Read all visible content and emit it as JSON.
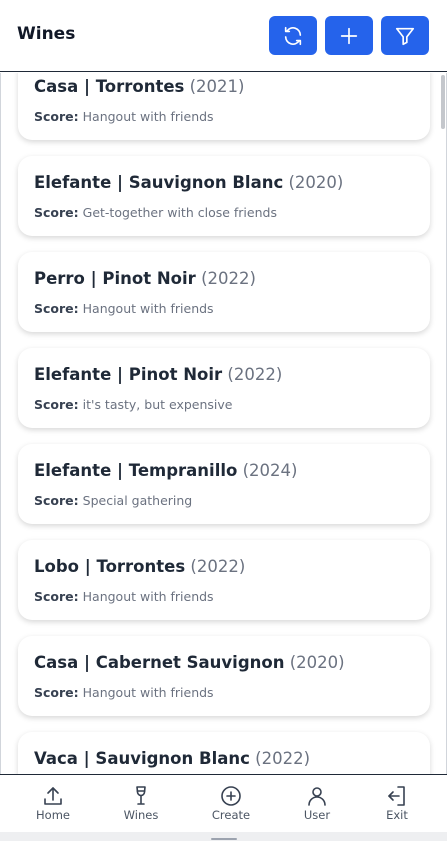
{
  "header": {
    "title": "Wines",
    "buttons": [
      {
        "name": "refresh",
        "icon": "refresh-icon"
      },
      {
        "name": "add",
        "icon": "plus-icon"
      },
      {
        "name": "filter",
        "icon": "filter-icon"
      }
    ],
    "accent": "#2563eb"
  },
  "score_label": "Score:",
  "wines": [
    {
      "name": "Casa | Torrontes",
      "year": "(2021)",
      "score": "Hangout with friends"
    },
    {
      "name": "Elefante | Sauvignon Blanc",
      "year": "(2020)",
      "score": "Get-together with close friends"
    },
    {
      "name": "Perro | Pinot Noir",
      "year": "(2022)",
      "score": "Hangout with friends"
    },
    {
      "name": "Elefante | Pinot Noir",
      "year": "(2022)",
      "score": "it's tasty, but expensive"
    },
    {
      "name": "Elefante | Tempranillo",
      "year": "(2024)",
      "score": "Special gathering"
    },
    {
      "name": "Lobo | Torrontes",
      "year": "(2022)",
      "score": "Hangout with friends"
    },
    {
      "name": "Casa | Cabernet Sauvignon",
      "year": "(2020)",
      "score": "Hangout with friends"
    },
    {
      "name": "Vaca | Sauvignon Blanc",
      "year": "(2022)",
      "score": ""
    }
  ],
  "tabs": [
    {
      "label": "Home",
      "icon": "home-upload-icon"
    },
    {
      "label": "Wines",
      "icon": "wine-glass-icon"
    },
    {
      "label": "Create",
      "icon": "plus-circle-icon"
    },
    {
      "label": "User",
      "icon": "user-icon"
    },
    {
      "label": "Exit",
      "icon": "exit-icon"
    }
  ]
}
